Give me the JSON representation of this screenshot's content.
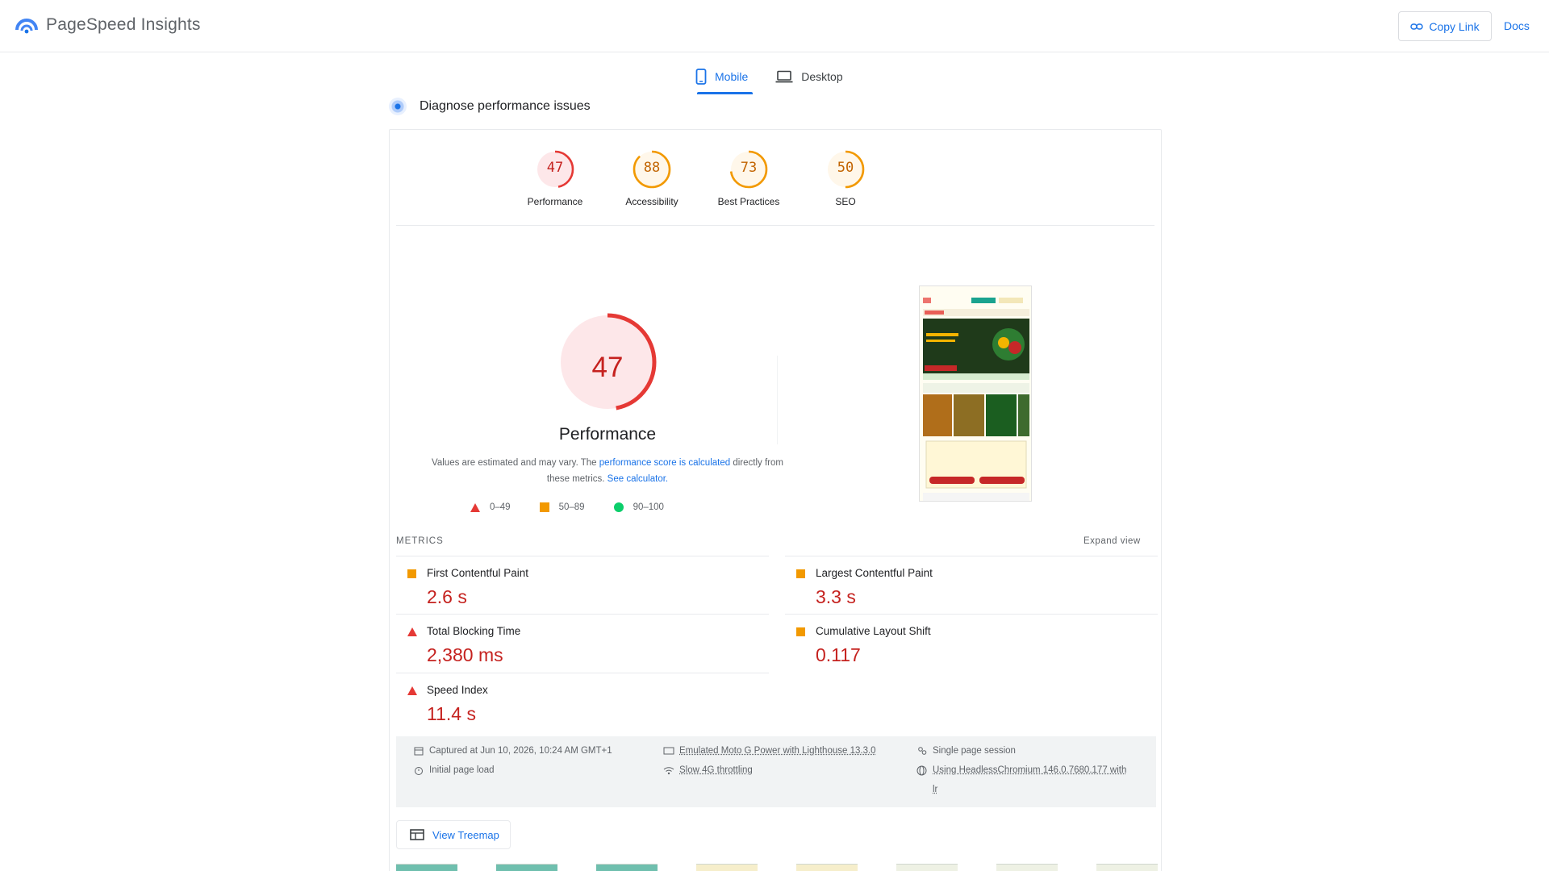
{
  "app": {
    "title": "PageSpeed Insights",
    "copy_link": "Copy Link",
    "docs": "Docs"
  },
  "tabs": [
    {
      "label": "Mobile",
      "icon": "smartphone-icon",
      "active": true
    },
    {
      "label": "Desktop",
      "icon": "laptop-icon",
      "active": false
    }
  ],
  "diagnose": {
    "title": "Diagnose performance issues"
  },
  "categories": [
    {
      "label": "Performance",
      "score": "47",
      "value": 47,
      "color": "#e53935",
      "fill": "#fde7e9"
    },
    {
      "label": "Accessibility",
      "score": "88",
      "value": 88,
      "color": "#f29900",
      "fill": "#fff7ea"
    },
    {
      "label": "Best Practices",
      "score": "73",
      "value": 73,
      "color": "#f29900",
      "fill": "#fff7ea"
    },
    {
      "label": "SEO",
      "score": "50",
      "value": 50,
      "color": "#f29900",
      "fill": "#fff7ea"
    }
  ],
  "performance": {
    "score": "47",
    "value": 47,
    "title": "Performance",
    "note_prefix": "Values are estimated and may vary. The ",
    "note_link1": "performance score is calculated",
    "note_mid": " directly from these metrics. ",
    "note_link2": "See calculator.",
    "legend": [
      {
        "range": "0–49",
        "shape": "triangle",
        "color": "#e53935"
      },
      {
        "range": "50–89",
        "shape": "square",
        "color": "#f29900"
      },
      {
        "range": "90–100",
        "shape": "circle",
        "color": "#0cce6b"
      }
    ]
  },
  "metrics": {
    "heading": "METRICS",
    "expand": "Expand view",
    "items": [
      {
        "name": "First Contentful Paint",
        "value": "2.6 s",
        "rating": "average"
      },
      {
        "name": "Largest Contentful Paint",
        "value": "3.3 s",
        "rating": "average"
      },
      {
        "name": "Total Blocking Time",
        "value": "2,380 ms",
        "rating": "fail"
      },
      {
        "name": "Cumulative Layout Shift",
        "value": "0.117",
        "rating": "average"
      },
      {
        "name": "Speed Index",
        "value": "11.4 s",
        "rating": "fail"
      }
    ]
  },
  "info": {
    "captured": "Captured at Jun 10, 2026, 10:24 AM GMT+1",
    "load": "Initial page load",
    "device": "Emulated Moto G Power with Lighthouse 13.3.0",
    "throttling": "Slow 4G throttling",
    "session": "Single page session",
    "browser_line1": "Using HeadlessChromium 146.0.7680.177 with",
    "browser_line2": "lr"
  },
  "treemap": {
    "label": "View Treemap"
  },
  "colors": {
    "accent": "#1a73e8",
    "fail": "#c5221f",
    "average": "#f29900",
    "pass": "#0cce6b"
  }
}
